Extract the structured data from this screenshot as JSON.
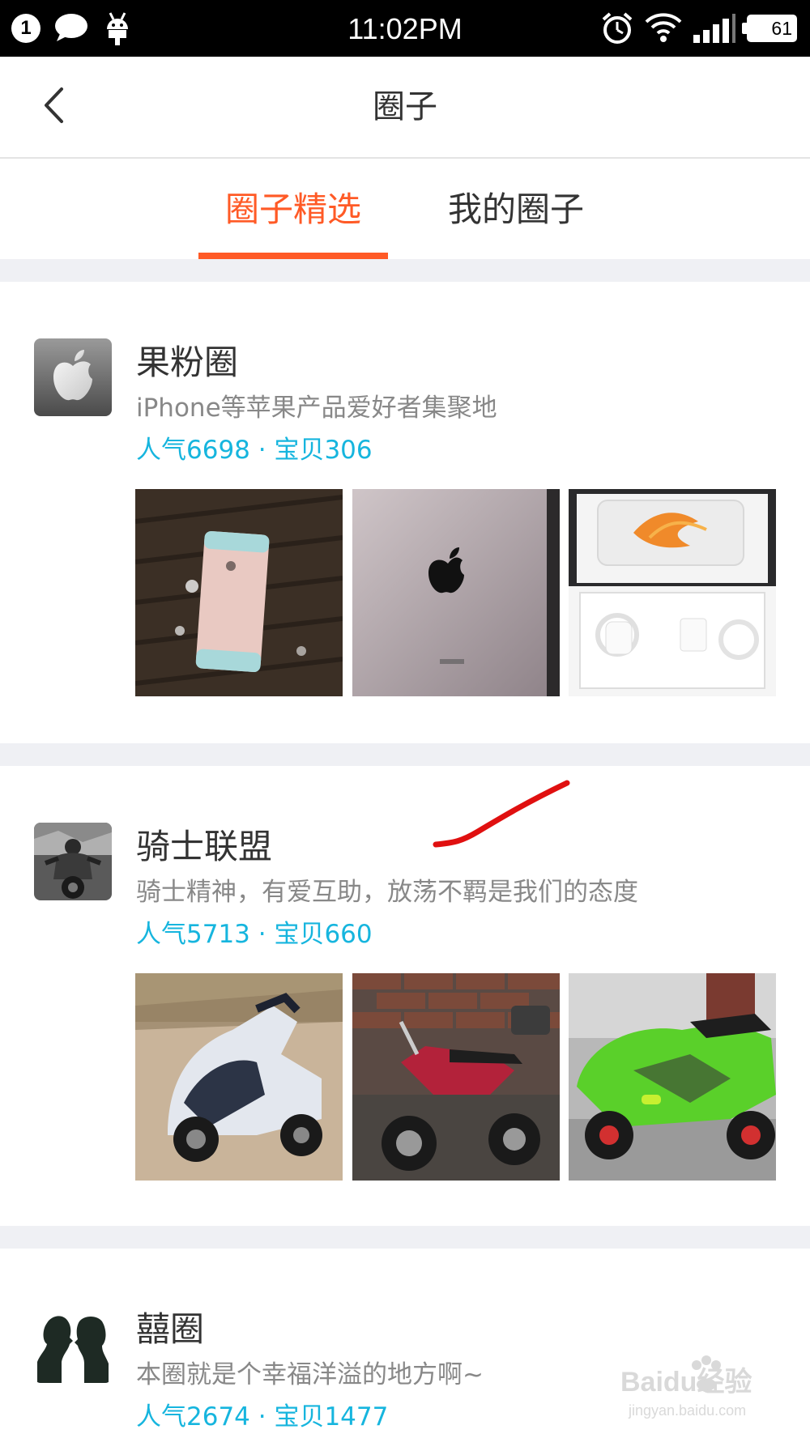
{
  "status_bar": {
    "notification_count": "1",
    "time": "11:02PM",
    "battery": "61",
    "icons": [
      "chat-bubble-icon",
      "android-icon",
      "alarm-icon",
      "wifi-icon",
      "signal-icon",
      "battery-icon"
    ]
  },
  "header": {
    "title": "圈子",
    "back_icon": "chevron-left-icon"
  },
  "tabs": [
    {
      "label": "圈子精选",
      "active": true
    },
    {
      "label": "我的圈子",
      "active": false
    }
  ],
  "colors": {
    "accent": "#ff5a26",
    "stats": "#16b5de",
    "separator": "#eff0f4",
    "annotation": "#e01010"
  },
  "circles": [
    {
      "name": "果粉圈",
      "description": "iPhone等苹果产品爱好者集聚地",
      "stats": "人气6698 · 宝贝306",
      "avatar": "apple-logo-avatar",
      "images": [
        "iphone-se-on-table-photo",
        "ipad-back-photo",
        "iphone-box-photo"
      ]
    },
    {
      "name": "骑士联盟",
      "description": "骑士精神，有爱互助，放荡不羁是我们的态度",
      "stats": "人气5713 · 宝贝660",
      "avatar": "biker-avatar",
      "images": [
        "white-scooter-photo",
        "red-motorcycle-photo",
        "green-sportbike-photo"
      ]
    },
    {
      "name": "囍圈",
      "description": "本圈就是个幸福洋溢的地方啊~",
      "stats": "人气2674 · 宝贝1477",
      "avatar": "couple-silhouette-avatar",
      "images": []
    }
  ],
  "watermark": {
    "brand": "Baidu经验",
    "url": "jingyan.baidu.com"
  }
}
